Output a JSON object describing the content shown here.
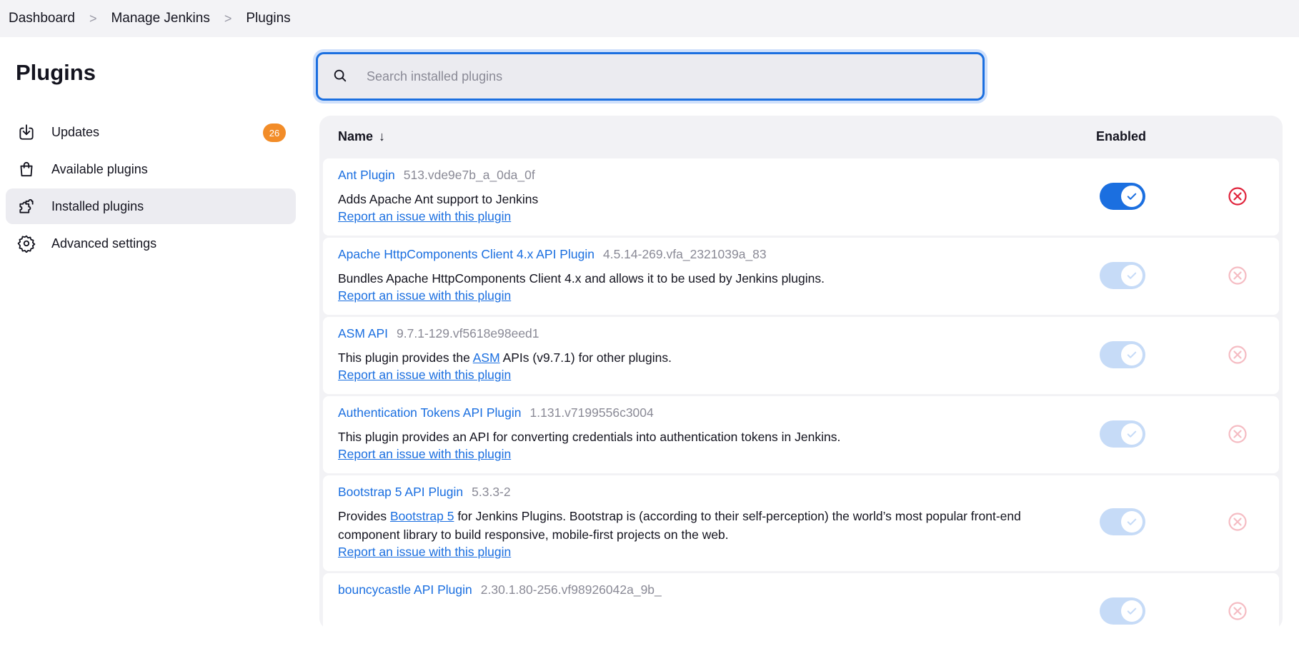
{
  "breadcrumb": {
    "items": [
      "Dashboard",
      "Manage Jenkins",
      "Plugins"
    ],
    "separator": ">"
  },
  "sidebar": {
    "title": "Plugins",
    "items": [
      {
        "label": "Updates",
        "icon": "download-icon",
        "badge": "26"
      },
      {
        "label": "Available plugins",
        "icon": "shopping-bag-icon"
      },
      {
        "label": "Installed plugins",
        "icon": "puzzle-icon",
        "active": true
      },
      {
        "label": "Advanced settings",
        "icon": "gear-icon"
      }
    ]
  },
  "search": {
    "placeholder": "Search installed plugins",
    "value": ""
  },
  "table": {
    "columns": {
      "name": "Name",
      "sort_arrow": "↓",
      "enabled": "Enabled"
    },
    "report_label": "Report an issue with this plugin",
    "plugins": [
      {
        "name": "Ant Plugin",
        "version": "513.vde9e7b_a_0da_0f",
        "description": "Adds Apache Ant support to Jenkins",
        "enabled": true,
        "locked": false
      },
      {
        "name": "Apache HttpComponents Client 4.x API Plugin",
        "version": "4.5.14-269.vfa_2321039a_83",
        "description": "Bundles Apache HttpComponents Client 4.x and allows it to be used by Jenkins plugins.",
        "enabled": true,
        "locked": true
      },
      {
        "name": "ASM API",
        "version": "9.7.1-129.vf5618e98eed1",
        "desc_before": "This plugin provides the ",
        "desc_link": "ASM",
        "desc_after": " APIs (v9.7.1) for other plugins.",
        "enabled": true,
        "locked": true
      },
      {
        "name": "Authentication Tokens API Plugin",
        "version": "1.131.v7199556c3004",
        "description": "This plugin provides an API for converting credentials into authentication tokens in Jenkins.",
        "enabled": true,
        "locked": true
      },
      {
        "name": "Bootstrap 5 API Plugin",
        "version": "5.3.3-2",
        "desc_before": "Provides ",
        "desc_link": "Bootstrap 5",
        "desc_after": " for Jenkins Plugins. Bootstrap is (according to their self-perception) the world’s most popular front-end component library to build responsive, mobile-first projects on the web.",
        "enabled": true,
        "locked": true
      },
      {
        "name": "bouncycastle API Plugin",
        "version": "2.30.1.80-256.vf98926042a_9b_",
        "enabled": true,
        "locked": true
      }
    ]
  },
  "colors": {
    "accent": "#1b6fe0",
    "badge": "#f28c28",
    "danger": "#e0243c"
  }
}
